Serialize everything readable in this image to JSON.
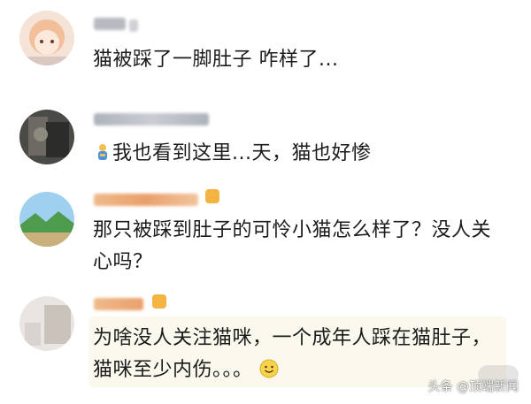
{
  "comments": [
    {
      "username": "...",
      "text": "猫被踩了一脚肚子 咋样了...",
      "avatar": "avatar-cartoon-girl-icon"
    },
    {
      "username": "...",
      "emoji": "person-emoji-icon",
      "text": "我也看到这里...天，猫也好惨",
      "avatar": "avatar-dark-photo-icon"
    },
    {
      "username": "...",
      "text": "那只被踩到肚子的可怜小猫怎么样了？没人关心吗？",
      "avatar": "avatar-landscape-icon"
    },
    {
      "username": "...",
      "text": "为啥没人关注猫咪，一个成年人踩在猫肚子，猫咪至少内伤。。。",
      "emoji": "smiley-emoji-icon",
      "avatar": "avatar-light-photo-icon"
    }
  ],
  "watermark": "头条 @顶端新闻",
  "colors": {
    "highlight_bg": "#fbf8ee",
    "badge": "#f3b441",
    "text": "#1b1b1b"
  }
}
